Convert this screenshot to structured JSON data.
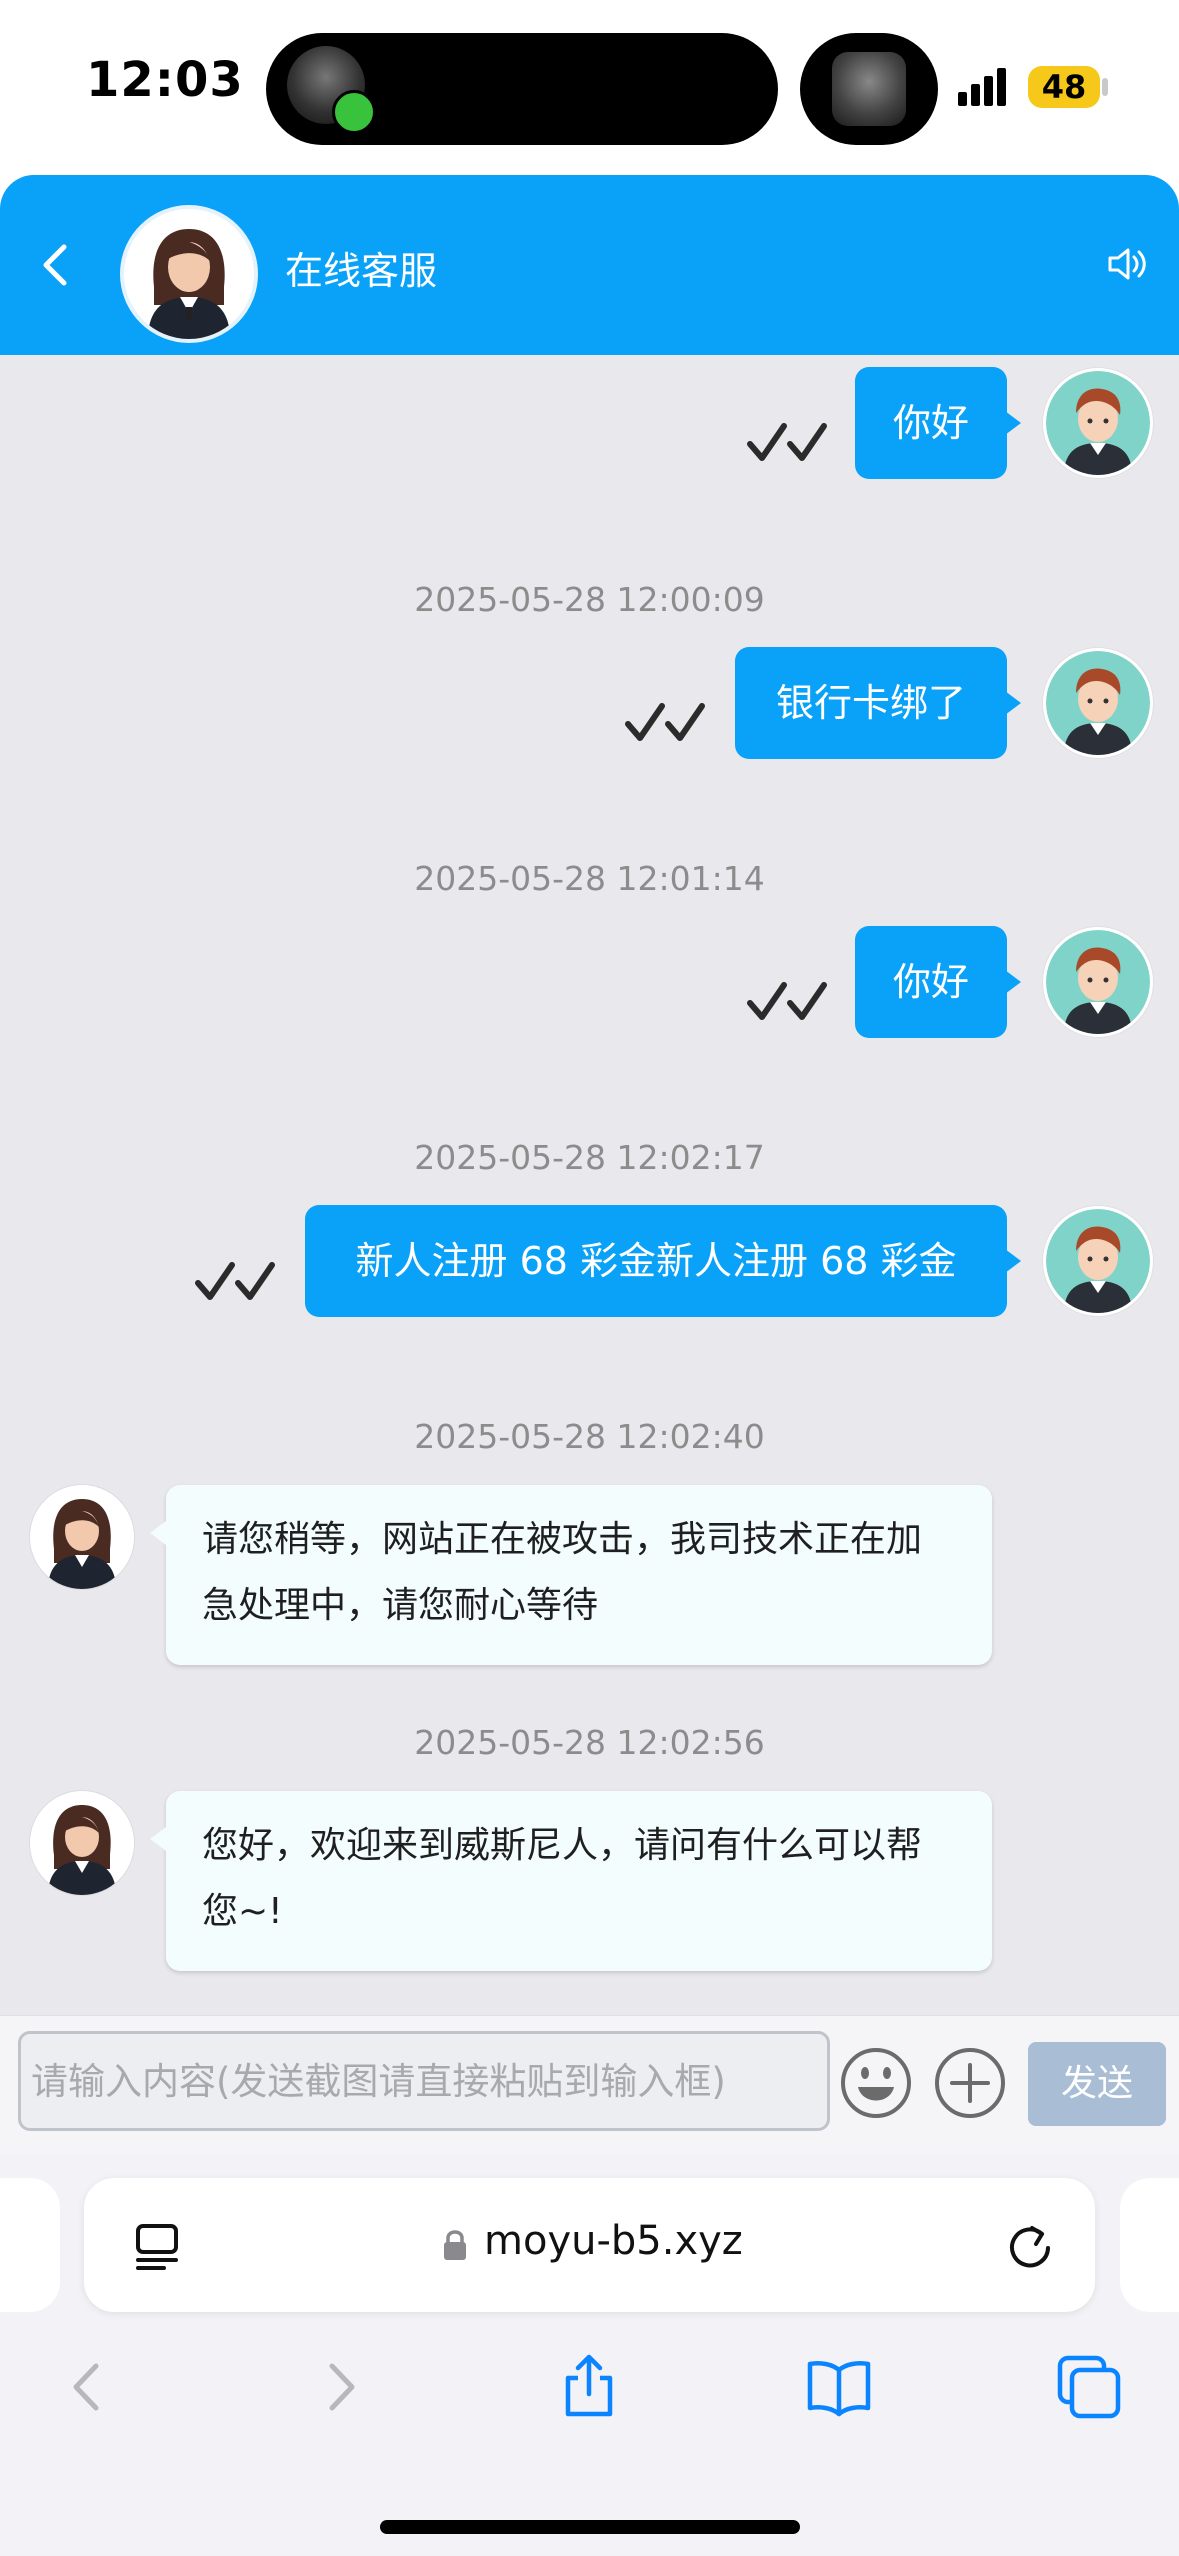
{
  "status_bar": {
    "time": "12:03",
    "battery": "48"
  },
  "header": {
    "title": "在线客服"
  },
  "messages": [
    {
      "sender": "user",
      "text": "你好",
      "timestamp": ""
    },
    {
      "sender": "user",
      "text": "银行卡绑了",
      "timestamp": "2025-05-28 12:00:09"
    },
    {
      "sender": "user",
      "text": "你好",
      "timestamp": "2025-05-28 12:01:14"
    },
    {
      "sender": "user",
      "text": "新人注册 68 彩金新人注册 68 彩金",
      "timestamp": "2025-05-28 12:02:17"
    },
    {
      "sender": "agent",
      "text": "请您稍等，网站正在被攻击，我司技术正在加急处理中，请您耐心等待",
      "timestamp": "2025-05-28 12:02:40"
    },
    {
      "sender": "agent",
      "text": "您好，欢迎来到威斯尼人，请问有什么可以帮您~!",
      "timestamp": "2025-05-28 12:02:56"
    }
  ],
  "input": {
    "placeholder": "请输入内容(发送截图请直接粘贴到输入框)",
    "value": "",
    "send_label": "发送"
  },
  "browser": {
    "url": "moyu-b5.xyz"
  },
  "colors": {
    "accent": "#0aa1f8",
    "chat_bg": "#e9e8ec",
    "agent_bubble": "#f3fdfd",
    "send_disabled": "#a9bdd5"
  },
  "icons": [
    "back-chevron-icon",
    "speaker-icon",
    "double-check-icon",
    "emoji-icon",
    "plus-icon",
    "tabs-icon",
    "lock-icon",
    "reload-icon",
    "back-arrow-icon",
    "forward-arrow-icon",
    "share-icon",
    "bookmarks-icon",
    "tab-overview-icon"
  ]
}
